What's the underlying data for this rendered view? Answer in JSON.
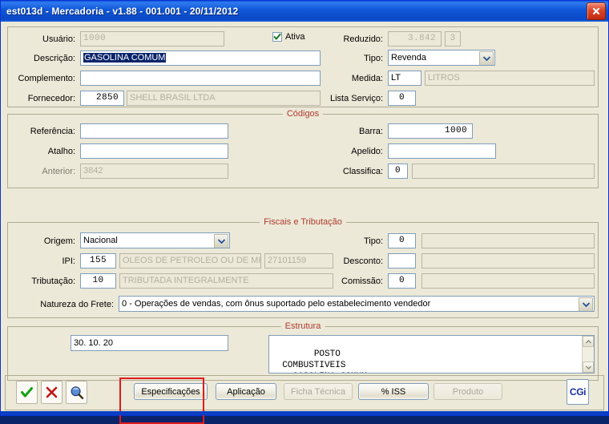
{
  "window": {
    "title": "est013d - Mercadoria - v1.88 - 001.001 - 20/11/2012",
    "close_label": "Close"
  },
  "top_section": {
    "usuario": {
      "label": "Usuário:",
      "value": "1000",
      "readonly": true
    },
    "ativa": {
      "label": "Ativa",
      "checked": true
    },
    "reduzido": {
      "label": "Reduzido:",
      "value": "3.842",
      "extra_value": "3",
      "readonly": true
    },
    "descricao": {
      "label": "Descrição:",
      "value": "GASOLINA COMUM",
      "selected": true
    },
    "tipo": {
      "label": "Tipo:",
      "value": "Revenda",
      "options": [
        "Revenda"
      ]
    },
    "complemento": {
      "label": "Complemento:",
      "value": ""
    },
    "medida": {
      "label": "Medida:",
      "value": "LT",
      "desc": "LITROS"
    },
    "fornecedor": {
      "label": "Fornecedor:",
      "code": "2850",
      "name": "SHELL BRASIL LTDA"
    },
    "lista_servico": {
      "label": "Lista Serviço:",
      "value": "0"
    }
  },
  "codigos": {
    "legend": "Códigos",
    "referencia": {
      "label": "Referência:",
      "value": ""
    },
    "barra": {
      "label": "Barra:",
      "value": "1000"
    },
    "atalho": {
      "label": "Atalho:",
      "value": ""
    },
    "apelido": {
      "label": "Apelido:",
      "value": ""
    },
    "anterior": {
      "label": "Anterior:",
      "value": "3842",
      "readonly": true
    },
    "classifica": {
      "label": "Classifica:",
      "value": "0",
      "desc": ""
    }
  },
  "fiscais": {
    "legend": "Fiscais e Tributação",
    "origem": {
      "label": "Origem:",
      "value": "Nacional",
      "options": [
        "Nacional"
      ]
    },
    "tipo": {
      "label": "Tipo:",
      "value": "0",
      "desc": ""
    },
    "ipi": {
      "label": "IPI:",
      "value": "155",
      "desc": "OLEOS DE PETROLEO OU DE MIN",
      "ncm": "27101159"
    },
    "desconto": {
      "label": "Desconto:",
      "value": "",
      "desc": ""
    },
    "tributacao": {
      "label": "Tributação:",
      "value": "10",
      "desc": "TRIBUTADA INTEGRALMENTE"
    },
    "comissao": {
      "label": "Comissão:",
      "value": "0",
      "desc": ""
    },
    "natureza_frete": {
      "label": "Natureza do Frete:",
      "value": "0 - Operações de vendas, com ônus suportado pelo estabelecimento vendedor",
      "options": [
        "0 - Operações de vendas, com ônus suportado pelo estabelecimento vendedor"
      ]
    }
  },
  "estrutura": {
    "legend": "Estrutura",
    "code": "30. 10. 20",
    "tree": "POSTO\n  COMBUSTIVEIS\n    GASOLINA COMUM"
  },
  "footer": {
    "icons": [
      {
        "name": "confirm-check-icon",
        "glyph": "check"
      },
      {
        "name": "cancel-x-icon",
        "glyph": "x"
      },
      {
        "name": "search-magnifier-icon",
        "glyph": "magnifier"
      }
    ],
    "buttons": [
      {
        "label": "Especificações",
        "disabled": false,
        "highlighted": true
      },
      {
        "label": "Aplicação",
        "disabled": false,
        "highlighted": false
      },
      {
        "label": "Ficha Técnica",
        "disabled": true,
        "highlighted": false
      },
      {
        "label": "% ISS",
        "disabled": false,
        "highlighted": false
      },
      {
        "label": "Produto",
        "disabled": true,
        "highlighted": false
      }
    ],
    "logo": {
      "text": "CGi",
      "name": "cgi-logo"
    }
  },
  "colors": {
    "title_bar": "#0a48c6",
    "form_background": "#ece9d8",
    "legend_text": "#b03a2e",
    "field_border": "#7f9db9",
    "selection": "#0a246a",
    "highlight_box": "#e01b1b",
    "status_bar": "#0a3fc4"
  }
}
